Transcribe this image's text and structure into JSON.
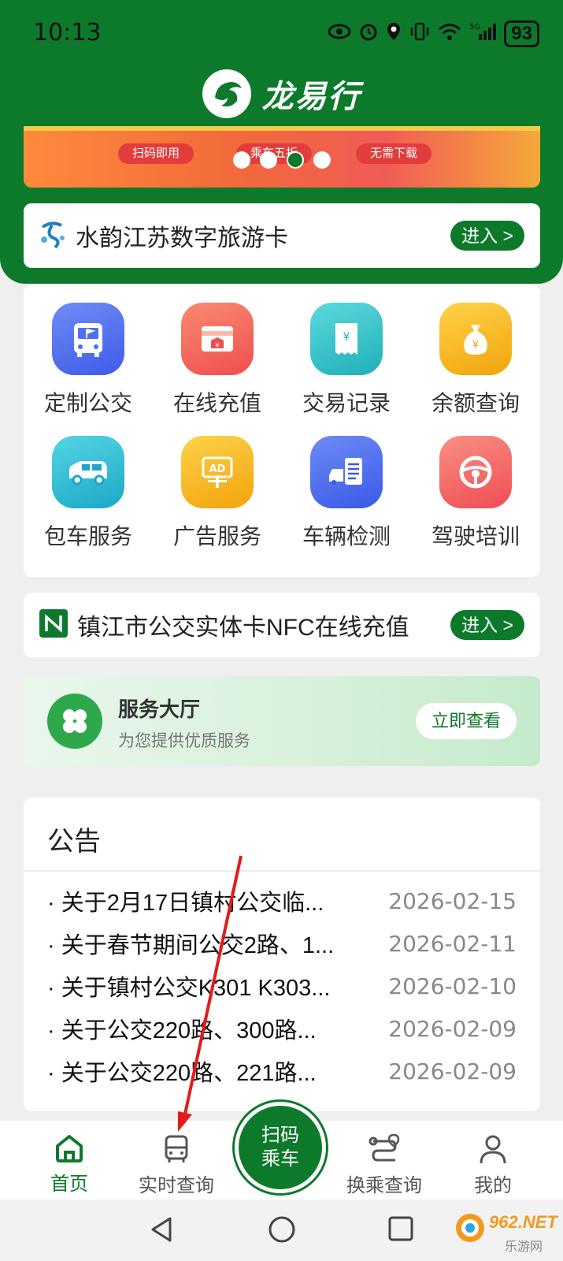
{
  "status_bar": {
    "time": "10:13",
    "battery": "93",
    "network": "5G"
  },
  "header": {
    "app_name": "龙易行"
  },
  "banner": {
    "tags": [
      "扫码即用",
      "乘车五折",
      "无需下载"
    ],
    "slide_count": 4,
    "active_slide": 3
  },
  "tourism_card": {
    "title": "水韵江苏数字旅游卡",
    "button": "进入 >"
  },
  "services": [
    {
      "label": "定制公交",
      "icon": "bus-flag-icon",
      "color": "#4f6ff0"
    },
    {
      "label": "在线充值",
      "icon": "recharge-card-icon",
      "color": "#f2645a"
    },
    {
      "label": "交易记录",
      "icon": "receipt-icon",
      "color": "#2fc3c8"
    },
    {
      "label": "余额查询",
      "icon": "money-bag-icon",
      "color": "#f5b41f"
    },
    {
      "label": "包车服务",
      "icon": "van-icon",
      "color": "#2bb9d1"
    },
    {
      "label": "广告服务",
      "icon": "ad-board-icon",
      "color": "#f6b51e"
    },
    {
      "label": "车辆检测",
      "icon": "car-inspection-icon",
      "color": "#4b6ef2"
    },
    {
      "label": "驾驶培训",
      "icon": "steering-wheel-icon",
      "color": "#f26660"
    }
  ],
  "nfc_card": {
    "title": "镇江市公交实体卡NFC在线充值",
    "button": "进入 >"
  },
  "service_hall": {
    "title": "服务大厅",
    "subtitle": "为您提供优质服务",
    "button": "立即查看"
  },
  "notice": {
    "title": "公告",
    "items": [
      {
        "text": "· 关于2月17日镇村公交临...",
        "date": "2026-02-15"
      },
      {
        "text": "· 关于春节期间公交2路、1...",
        "date": "2026-02-11"
      },
      {
        "text": "· 关于镇村公交K301 K303...",
        "date": "2026-02-10"
      },
      {
        "text": "· 关于公交220路、300路...",
        "date": "2026-02-09"
      },
      {
        "text": "· 关于公交220路、221路...",
        "date": "2026-02-09"
      }
    ]
  },
  "tabbar": {
    "home": "首页",
    "realtime": "实时查询",
    "scan_line1": "扫码",
    "scan_line2": "乘车",
    "transfer": "换乘查询",
    "mine": "我的"
  },
  "watermark": {
    "text": "962.NET",
    "subtext": "乐游网"
  },
  "colors": {
    "brand_green": "#0d7a2b",
    "background": "#efefef"
  }
}
